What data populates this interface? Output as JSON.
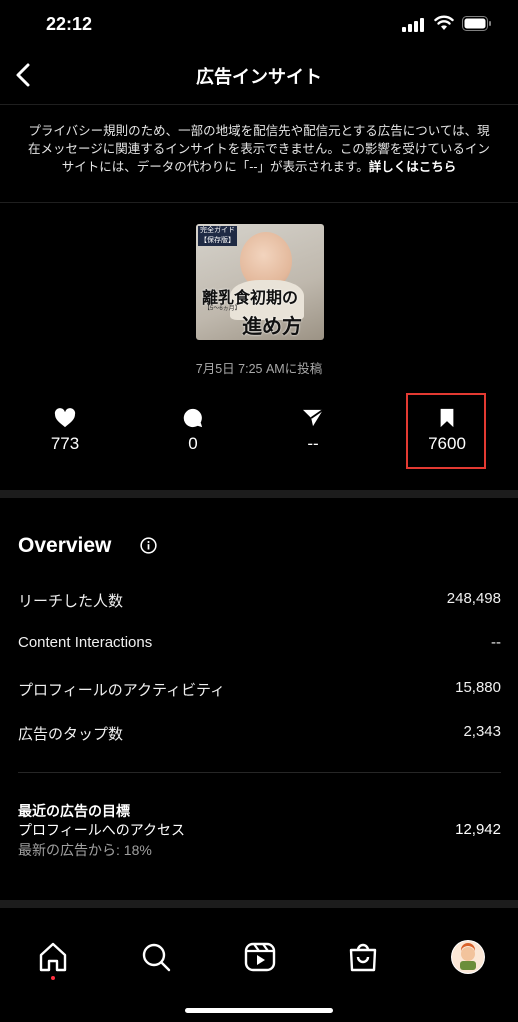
{
  "status_bar": {
    "time": "22:12"
  },
  "header": {
    "title": "広告インサイト"
  },
  "notice": {
    "text": "プライバシー規則のため、一部の地域を配信先や配信元とする広告については、現在メッセージに関連するインサイトを表示できません。この影響を受けているインサイトには、データの代わりに「--」が表示されます。",
    "link": "詳しくはこちら"
  },
  "post": {
    "thumbnail": {
      "tag1": "完全ガイド",
      "tag2": "【保存版】",
      "line1": "離乳食初期の",
      "line2": "【5〜6ヵ月】",
      "line3": "進め方"
    },
    "posted_at": "7月5日 7:25 AMに投稿"
  },
  "stats": {
    "likes": {
      "icon": "heart-icon",
      "value": "773"
    },
    "comments": {
      "icon": "comment-icon",
      "value": "0"
    },
    "shares": {
      "icon": "send-icon",
      "value": "--"
    },
    "saves": {
      "icon": "bookmark-icon",
      "value": "7600"
    }
  },
  "overview": {
    "title": "Overview",
    "rows": [
      {
        "label": "リーチした人数",
        "value": "248,498"
      },
      {
        "label": "Content Interactions",
        "value": "--"
      },
      {
        "label": "プロフィールのアクティビティ",
        "value": "15,880"
      },
      {
        "label": "広告のタップ数",
        "value": "2,343"
      }
    ],
    "goal": {
      "heading": "最近の広告の目標",
      "label": "プロフィールへのアクセス",
      "sub": "最新の広告から: 18%",
      "value": "12,942"
    }
  },
  "tabbar": [
    "home-icon",
    "search-icon",
    "reels-icon",
    "shop-icon",
    "profile-avatar"
  ],
  "colors": {
    "background": "#000000",
    "highlight": "#e33a32",
    "notification_dot": "#ff3040"
  }
}
